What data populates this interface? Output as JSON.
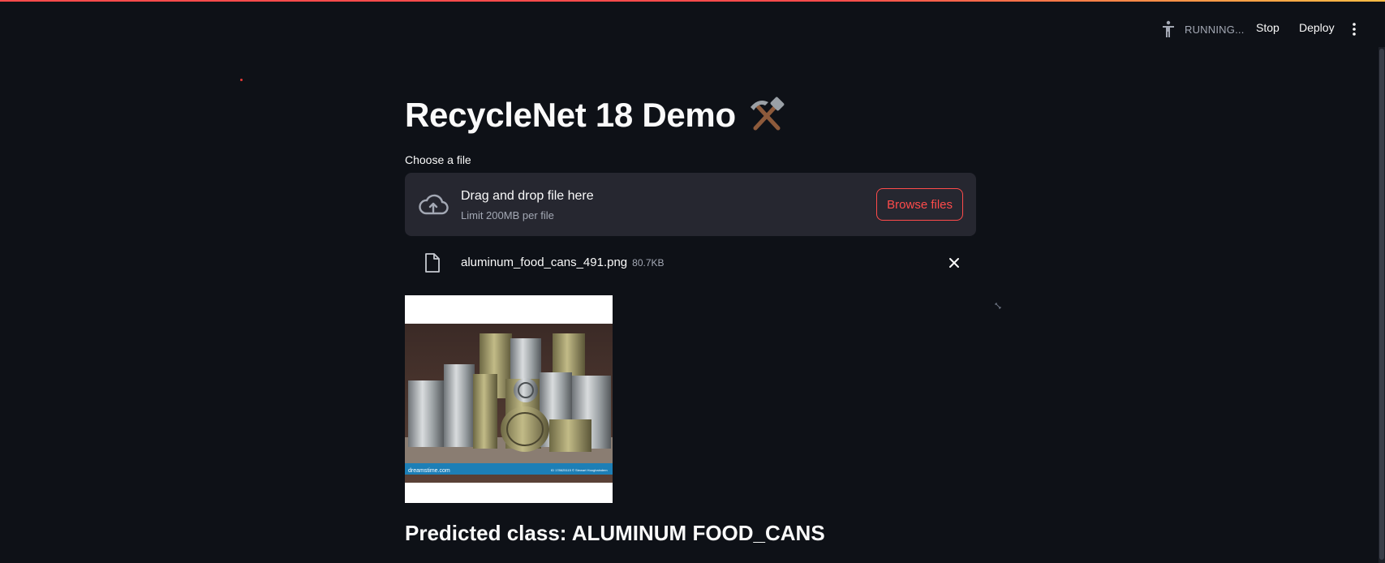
{
  "header": {
    "status_text": "RUNNING...",
    "stop_label": "Stop",
    "deploy_label": "Deploy",
    "running_icon": "running-man-icon",
    "menu_icon": "kebab-menu-icon"
  },
  "main": {
    "title": "RecycleNet 18 Demo",
    "title_emoji": "hammer-and-pick-icon",
    "uploader": {
      "label": "Choose a file",
      "drop_text": "Drag and drop file here",
      "limit_text": "Limit 200MB per file",
      "browse_label": "Browse files",
      "icon": "cloud-upload-icon"
    },
    "uploaded_file": {
      "name": "aluminum_food_cans_491.png",
      "size": "80.7KB",
      "icon": "file-icon",
      "remove_icon": "close-icon"
    },
    "image_watermark": {
      "site": "dreamstime.com",
      "id_text": "ID 178625115 © Stewart Hoogbaindem"
    },
    "prediction": "Predicted class: ALUMINUM FOOD_CANS"
  },
  "colors": {
    "background": "#0e1117",
    "surface": "#262730",
    "accent": "#ff4b4b",
    "text": "#fafafa",
    "muted": "#a3a8b4"
  }
}
